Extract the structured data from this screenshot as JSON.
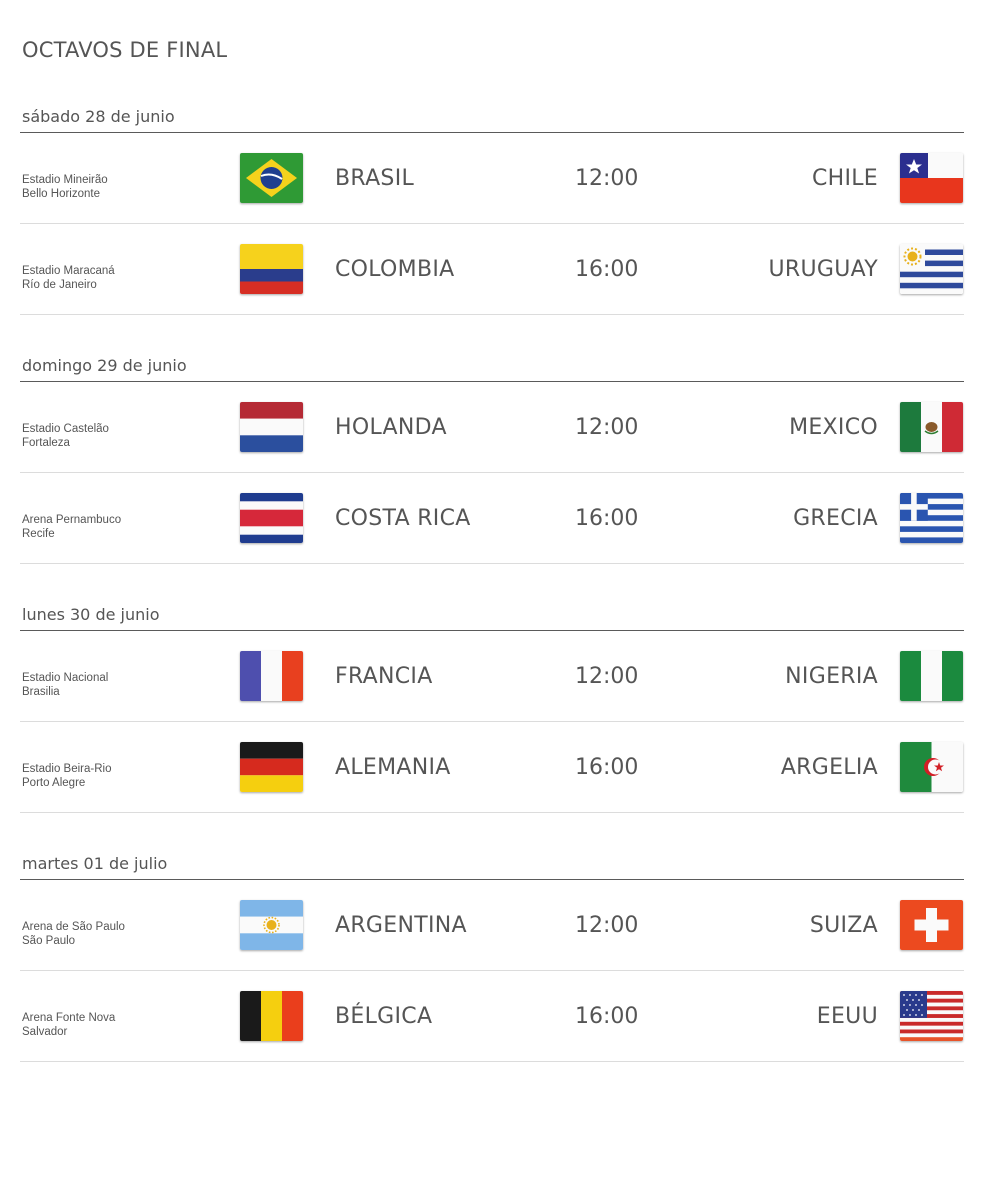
{
  "page": {
    "title": "OCTAVOS DE FINAL"
  },
  "days": [
    {
      "label": "sábado 28 de junio",
      "matches": [
        {
          "venue": "Estadio Mineirão",
          "city": "Bello Horizonte",
          "home": "BRASIL",
          "time": "12:00",
          "away": "CHILE",
          "home_flag": "brazil-flag-icon",
          "away_flag": "chile-flag-icon"
        },
        {
          "venue": "Estadio Maracaná",
          "city": "Río de Janeiro",
          "home": "COLOMBIA",
          "time": "16:00",
          "away": "URUGUAY",
          "home_flag": "colombia-flag-icon",
          "away_flag": "uruguay-flag-icon"
        }
      ]
    },
    {
      "label": "domingo 29 de junio",
      "matches": [
        {
          "venue": "Estadio Castelão",
          "city": "Fortaleza",
          "home": "HOLANDA",
          "time": "12:00",
          "away": "MEXICO",
          "home_flag": "netherlands-flag-icon",
          "away_flag": "mexico-flag-icon"
        },
        {
          "venue": "Arena Pernambuco",
          "city": "Recife",
          "home": "COSTA RICA",
          "time": "16:00",
          "away": "GRECIA",
          "home_flag": "costa-rica-flag-icon",
          "away_flag": "greece-flag-icon"
        }
      ]
    },
    {
      "label": "lunes 30 de junio",
      "matches": [
        {
          "venue": "Estadio Nacional",
          "city": "Brasilia",
          "home": "FRANCIA",
          "time": "12:00",
          "away": "NIGERIA",
          "home_flag": "france-flag-icon",
          "away_flag": "nigeria-flag-icon"
        },
        {
          "venue": "Estadio Beira-Rio",
          "city": "Porto Alegre",
          "home": "ALEMANIA",
          "time": "16:00",
          "away": "ARGELIA",
          "home_flag": "germany-flag-icon",
          "away_flag": "algeria-flag-icon"
        }
      ]
    },
    {
      "label": "martes 01 de julio",
      "matches": [
        {
          "venue": "Arena de São Paulo",
          "city": "São Paulo",
          "home": "ARGENTINA",
          "time": "12:00",
          "away": "SUIZA",
          "home_flag": "argentina-flag-icon",
          "away_flag": "switzerland-flag-icon"
        },
        {
          "venue": "Arena Fonte Nova",
          "city": "Salvador",
          "home": "BÉLGICA",
          "time": "16:00",
          "away": "EEUU",
          "home_flag": "belgium-flag-icon",
          "away_flag": "usa-flag-icon"
        }
      ]
    }
  ]
}
